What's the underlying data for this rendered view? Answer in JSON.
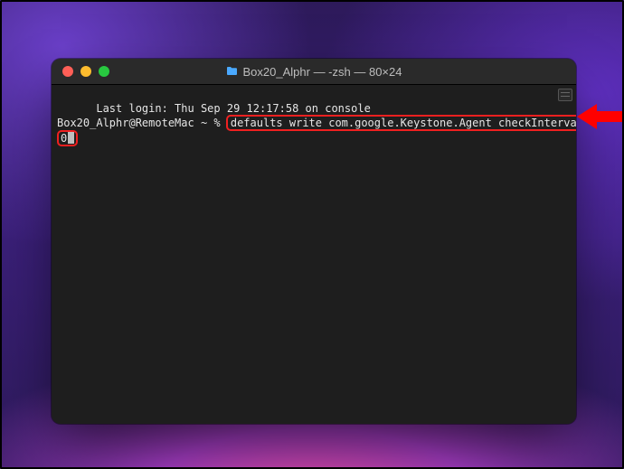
{
  "window": {
    "title": "Box20_Alphr — -zsh — 80×24"
  },
  "terminal": {
    "last_login_line": "Last login: Thu Sep 29 12:17:58 on console",
    "prompt": "Box20_Alphr@RemoteMac ~ % ",
    "command_part1": "defaults write com.google.Keystone.Agent checkInterval",
    "command_part2": "0"
  }
}
